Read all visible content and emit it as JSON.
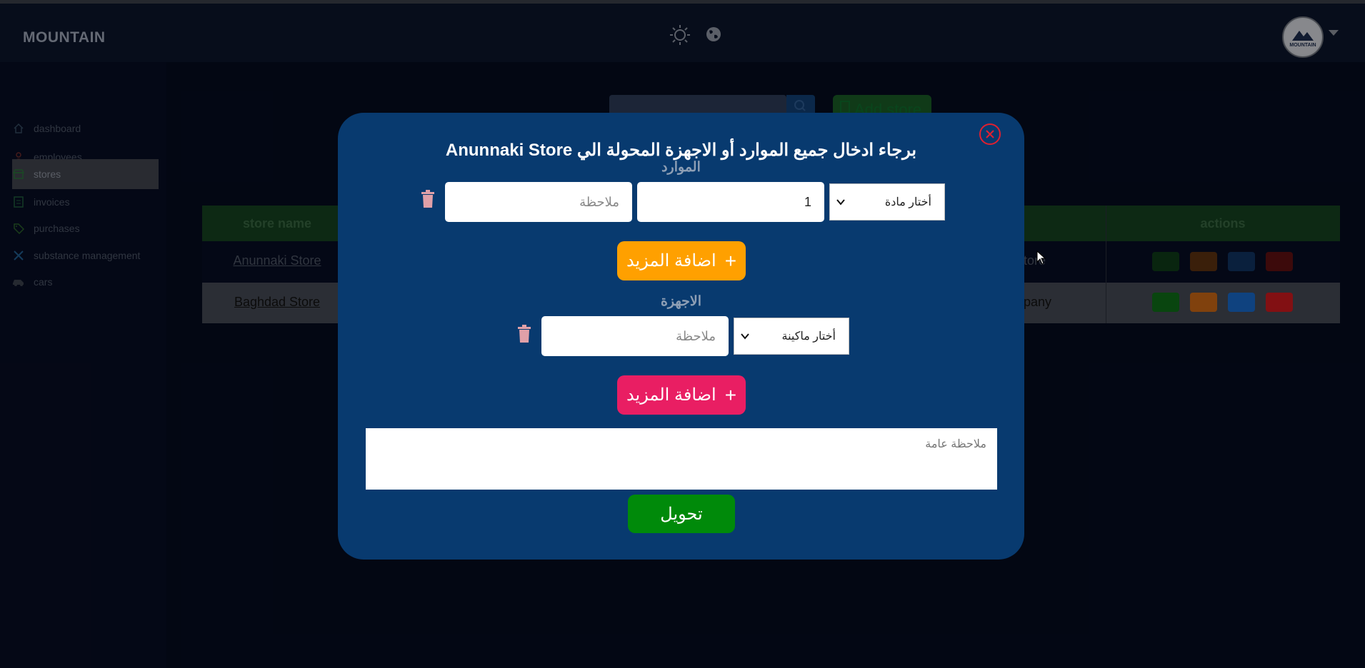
{
  "app": {
    "brand": "MOUNTAIN"
  },
  "header": {
    "theme_icon": "sun-icon",
    "language_icon": "globe-icon",
    "avatar_text": "MOUNTAIN",
    "menu_icon": "caret-down-icon"
  },
  "sidebar": {
    "items": [
      {
        "label": "dashboard",
        "icon": "home-icon",
        "active": false
      },
      {
        "label": "employees",
        "icon": "user-icon",
        "active": false
      },
      {
        "label": "stores",
        "icon": "store-icon",
        "active": true
      },
      {
        "label": "invoices",
        "icon": "document-icon",
        "active": false
      },
      {
        "label": "purchases",
        "icon": "tag-icon",
        "active": false
      },
      {
        "label": "substance management",
        "icon": "tools-icon",
        "active": false
      },
      {
        "label": "cars",
        "icon": "car-icon",
        "active": false
      }
    ]
  },
  "toolbar": {
    "add_store_label": "Add store"
  },
  "table": {
    "headers": {
      "name": "store name",
      "actions": "actions"
    },
    "rows": [
      {
        "name": "Anunnaki Store",
        "partial": "tore"
      },
      {
        "name": "Baghdad Store",
        "partial": "pany"
      }
    ],
    "action_colors": [
      "#0f6a18",
      "#c56414",
      "#1766c4",
      "#c8191e"
    ]
  },
  "modal": {
    "title": "برجاء ادخال جميع الموارد أو الاجهزة المحولة الي Anunnaki Store",
    "resources": {
      "heading": "الموارد",
      "select_label": "أختار مادة",
      "quantity_value": "1",
      "note_placeholder": "ملاحظة",
      "add_more_label": "اضافة المزيد",
      "add_more_color": "#ffa000"
    },
    "devices": {
      "heading": "الاجهزة",
      "select_label": "أختار ماكينة",
      "note_placeholder": "ملاحظة",
      "add_more_label": "اضافة المزيد",
      "add_more_color": "#e91e63"
    },
    "general_note_placeholder": "ملاحظة عامة",
    "submit_label": "تحويل"
  }
}
